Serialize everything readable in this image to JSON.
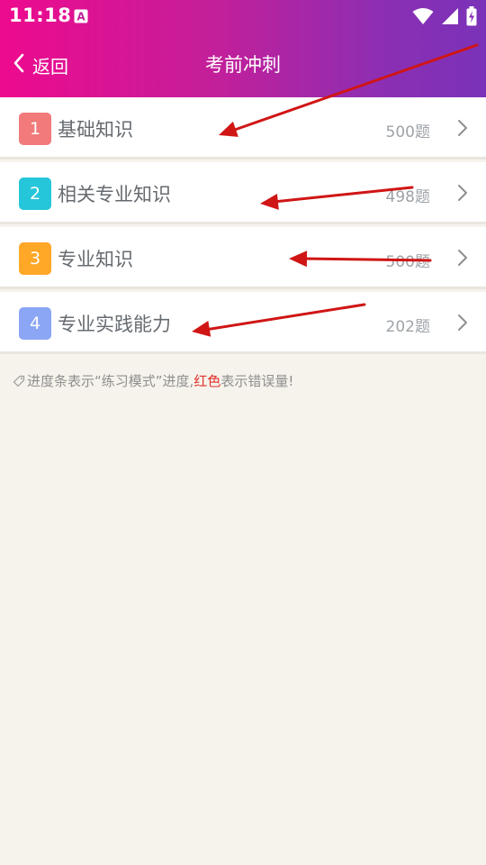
{
  "status_bar": {
    "time": "11:18",
    "app_icon_letter": "A"
  },
  "nav": {
    "back_label": "返回",
    "title": "考前冲刺"
  },
  "items": [
    {
      "index": "1",
      "name": "基础知识",
      "count": "500题",
      "badge_color": "#f27a7a"
    },
    {
      "index": "2",
      "name": "相关专业知识",
      "count": "498题",
      "badge_color": "#26c6da"
    },
    {
      "index": "3",
      "name": "专业知识",
      "count": "500题",
      "badge_color": "#ffa726"
    },
    {
      "index": "4",
      "name": "专业实践能力",
      "count": "202题",
      "badge_color": "#8aa6f5"
    }
  ],
  "note": {
    "prefix": "进度条表示“练习模式”进度,",
    "highlight": "红色",
    "suffix": "表示错误量!"
  },
  "colors": {
    "annotation_arrow": "#d01515",
    "error_highlight": "#e2312b"
  }
}
